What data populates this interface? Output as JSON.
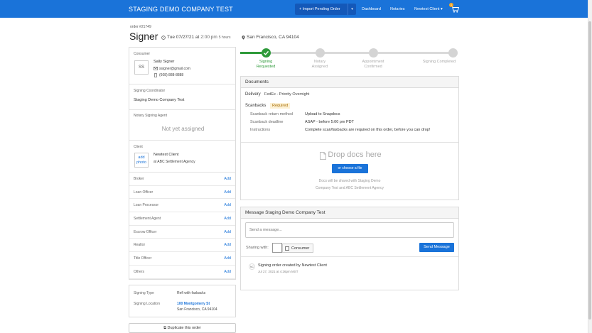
{
  "header": {
    "brand": "STAGING DEMO COMPANY TEST",
    "import_label": "+ Import Pending Order",
    "import_caret": "▾",
    "nav": [
      "Dashboard",
      "Notaries",
      "Newtest Client ▾"
    ],
    "cart_count": "1",
    "accent": "#1a73d9"
  },
  "order": {
    "number": "order #21749",
    "title": "Signer",
    "date": "Tue 07/27/21 at",
    "time": "2:00 pm",
    "duration": "5 hours",
    "location": "San Francisco, CA 94104"
  },
  "consumer": {
    "label": "Consumer",
    "initials": "SS",
    "name": "Sally Signer",
    "email": "ssigner@gmail.com",
    "phone": "(608) 888-8888"
  },
  "coordinator": {
    "label": "Signing Coordinator",
    "value": "Staging Demo Company Test"
  },
  "notary": {
    "label": "Notary Signing Agent",
    "value": "Not yet assigned"
  },
  "client": {
    "label": "Client",
    "add_photo_1": "add",
    "add_photo_2": "photo",
    "name": "Newtest Client",
    "company": "at ABC Settlement Agency"
  },
  "roles": [
    {
      "label": "Broker",
      "action": "Add"
    },
    {
      "label": "Loan Officer",
      "action": "Add"
    },
    {
      "label": "Loan Processor",
      "action": "Add"
    },
    {
      "label": "Settlement Agent",
      "action": "Add"
    },
    {
      "label": "Escrow Officer",
      "action": "Add"
    },
    {
      "label": "Realtor",
      "action": "Add"
    },
    {
      "label": "Title Officer",
      "action": "Add"
    },
    {
      "label": "Others",
      "action": "Add"
    }
  ],
  "signing": {
    "type_label": "Signing Type",
    "type_value": "Refi with faxbacks",
    "location_label": "Signing Location",
    "street": "100 Montgomery St",
    "city": "San Francisco, CA 94104"
  },
  "duplicate_label": "Duplicate this order",
  "steps": [
    {
      "line1": "Signing",
      "line2": "Requested",
      "done": true
    },
    {
      "line1": "Notary",
      "line2": "Assigned",
      "done": false
    },
    {
      "line1": "Appointment",
      "line2": "Confirmed",
      "done": false
    },
    {
      "line1": "Signing Completed",
      "line2": "",
      "done": false
    }
  ],
  "documents": {
    "title": "Documents",
    "delivery_label": "Delivery",
    "delivery_value": "FedEx - Priority Overnight",
    "scanbacks_label": "Scanbacks",
    "scanbacks_badge": "Required",
    "rows": [
      {
        "label": "Scanback return method",
        "value": "Upload to Snapdocs"
      },
      {
        "label": "Scanback deadline",
        "value": "ASAP - before 5:00 pm PDT"
      },
      {
        "label": "Instructions",
        "value": "Complete scan/faxbacks are required on this order, before you can drop!"
      }
    ],
    "drop_title": "Drop docs here",
    "choose_label": "or choose a file",
    "note_1": "Docs will be shared with Staging Demo",
    "note_2": "Company Test and ABC Settlement Agency"
  },
  "message": {
    "title": "Message Staging Demo Company Test",
    "placeholder": "Send a message...",
    "sharing_label": "Sharing with:",
    "consumer_checkbox": "Consumer",
    "send_label": "Send Message",
    "activity_initials": "NC",
    "activity_text_1": "Signing order created by",
    "activity_author": "Newtest Client",
    "activity_time": "Jul 27, 2021 at 4:26pm MST"
  }
}
